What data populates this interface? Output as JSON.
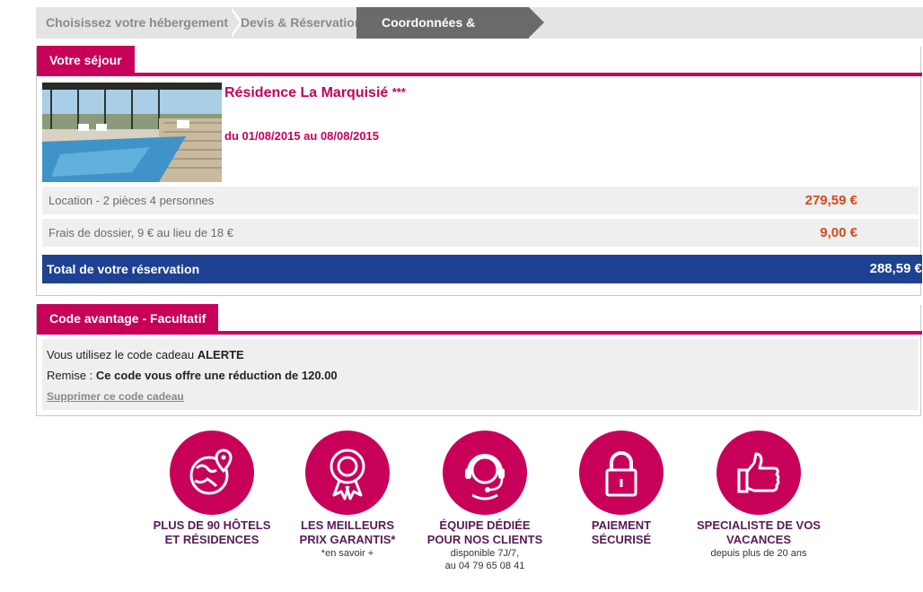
{
  "steps": {
    "step1": "Choisissez votre hébergement",
    "step2": "Devis & Réservation",
    "step3": "Coordonnées & Paiement"
  },
  "sejour": {
    "header": "Votre séjour",
    "residence_name": "Résidence La Marquisié",
    "stars": "***",
    "dates": "du 01/08/2015 au 08/08/2015",
    "lines": [
      {
        "label": "Location - 2 pièces 4 personnes",
        "amount": "279,59 €"
      },
      {
        "label": "Frais de dossier, 9 € au lieu de 18 €",
        "amount": "9,00 €"
      }
    ],
    "total_label": "Total de votre réservation",
    "total_amount": "288,59 €"
  },
  "code": {
    "header": "Code avantage - Facultatif",
    "line1_prefix": "Vous utilisez le code cadeau",
    "code_value": "ALERTE",
    "line2_prefix": "Remise :",
    "line2_value": "Ce code vous offre une réduction de 120.00",
    "remove_link": "Supprimer ce code cadeau"
  },
  "features": [
    {
      "title1": "PLUS DE 90 HÔTELS",
      "title2": "ET RÉSIDENCES",
      "sub1": "",
      "sub2": "",
      "icon": "globe-pin-icon"
    },
    {
      "title1": "LES MEILLEURS",
      "title2": "PRIX GARANTIS*",
      "sub1": "*en savoir +",
      "sub2": "",
      "icon": "award-ribbon-icon"
    },
    {
      "title1": "ÉQUIPE DÉDIÉE",
      "title2": "POUR NOS CLIENTS",
      "sub1": "disponible 7J/7,",
      "sub2": "au 04 79 65 08 41",
      "icon": "headset-agent-icon"
    },
    {
      "title1": "PAIEMENT",
      "title2": "SÉCURISÉ",
      "sub1": "",
      "sub2": "",
      "icon": "padlock-icon"
    },
    {
      "title1": "SPECIALISTE DE VOS",
      "title2": "VACANCES",
      "sub1": "depuis plus de 20 ans",
      "sub2": "",
      "icon": "thumbs-up-icon"
    }
  ],
  "colors": {
    "accent": "#c8005a",
    "total_bar": "#1e4192",
    "price": "#d24a1c",
    "feature_title": "#5a1a58"
  }
}
